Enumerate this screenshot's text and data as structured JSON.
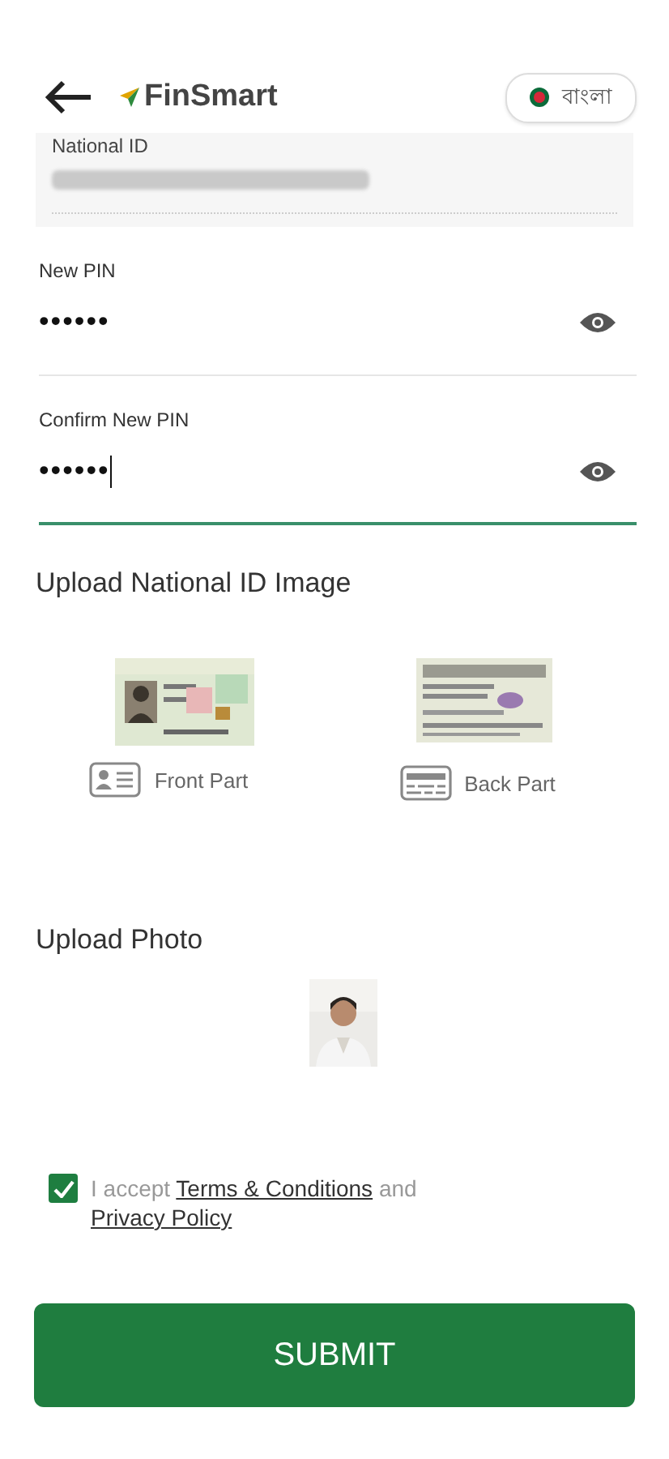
{
  "header": {
    "brand": "FinSmart",
    "language": "বাংলা"
  },
  "national_id": {
    "label": "National ID",
    "kind": "redacted"
  },
  "pin_fields": [
    {
      "label": "New PIN",
      "value": "••••••",
      "focused": false
    },
    {
      "label": "Confirm New PIN",
      "value": "••••••",
      "focused": true
    }
  ],
  "id_upload": {
    "title": "Upload National ID Image",
    "parts": [
      {
        "caption": "Front Part",
        "kind": "front"
      },
      {
        "caption": "Back Part",
        "kind": "back"
      }
    ]
  },
  "photo_upload": {
    "title": "Upload Photo"
  },
  "consent": {
    "checked": true,
    "prefix": "I accept",
    "terms_link": "Terms & Conditions",
    "middle": "and",
    "privacy_link": "Privacy Policy"
  },
  "submit": "SUBMIT"
}
